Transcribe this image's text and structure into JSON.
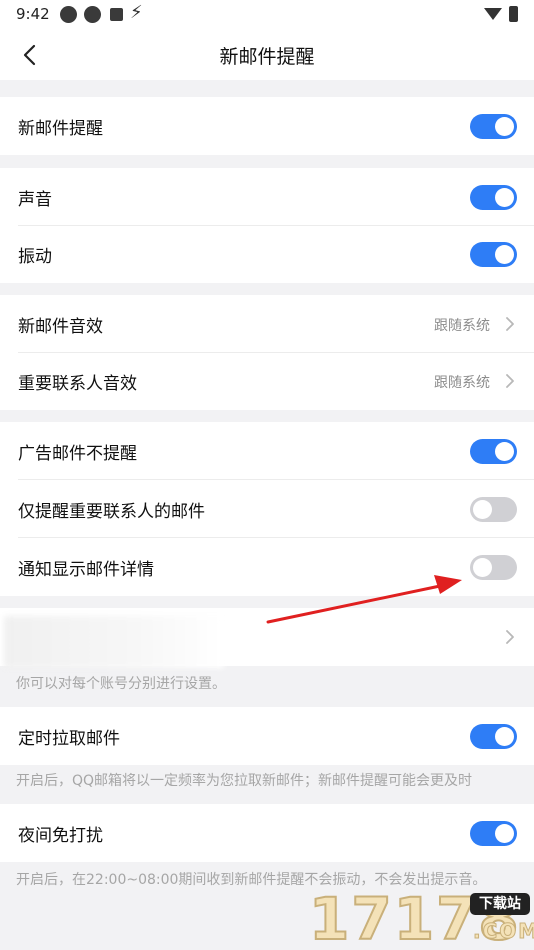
{
  "status_bar": {
    "time": "9:42"
  },
  "header": {
    "title": "新邮件提醒"
  },
  "rows": {
    "new_mail": {
      "label": "新邮件提醒",
      "on": true
    },
    "sound": {
      "label": "声音",
      "on": true
    },
    "vibrate": {
      "label": "振动",
      "on": true
    },
    "new_mail_sound": {
      "label": "新邮件音效",
      "value": "跟随系统"
    },
    "vip_sound": {
      "label": "重要联系人音效",
      "value": "跟随系统"
    },
    "no_ad_alert": {
      "label": "广告邮件不提醒",
      "on": true
    },
    "vip_only": {
      "label": "仅提醒重要联系人的邮件",
      "on": false
    },
    "show_detail": {
      "label": "通知显示邮件详情",
      "on": false
    },
    "scheduled_fetch": {
      "label": "定时拉取邮件",
      "on": true
    },
    "night_dnd": {
      "label": "夜间免打扰",
      "on": true
    }
  },
  "notes": {
    "account": "你可以对每个账号分别进行设置。",
    "fetch": "开启后，QQ邮箱将以一定频率为您拉取新邮件；新邮件提醒可能会更及时",
    "night": "开启后，在22:00~08:00期间收到新邮件提醒不会振动，不会发出提示音。"
  },
  "watermark": {
    "digits": "17178",
    "badge": "下载站",
    "domain": ".COM"
  },
  "colors": {
    "toggle_on": "#2e7df6",
    "toggle_off": "#d0d0d4",
    "arrow": "#e02020"
  }
}
